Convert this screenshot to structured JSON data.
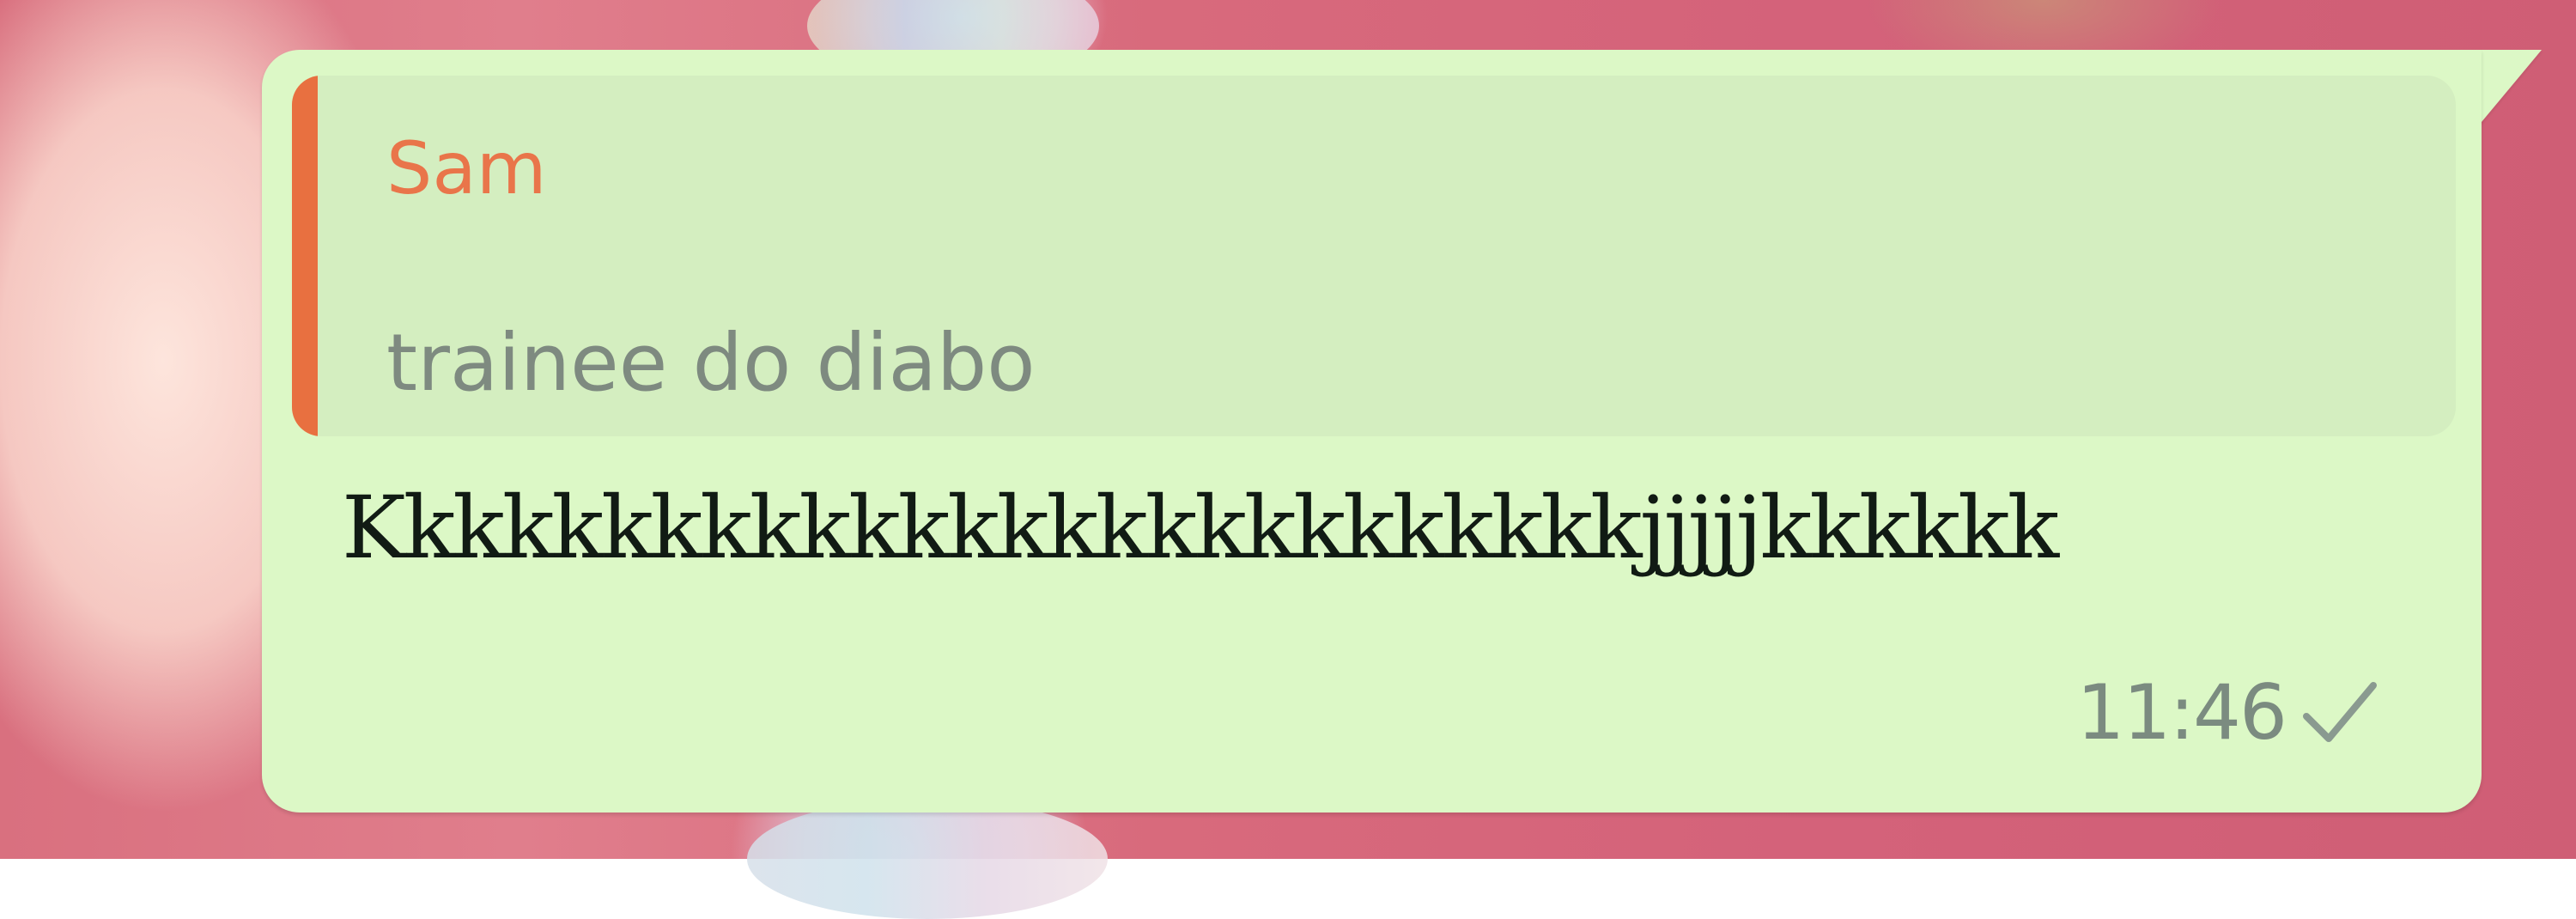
{
  "reply": {
    "sender": "Sam",
    "quoted_text": "trainee do diabo"
  },
  "message": {
    "text": "Kkkkkkkkkkkkkkkkkkkkkkkkkkjjjjjkkkkkk",
    "time": "11:46",
    "status_icon": "single-check-icon"
  },
  "colors": {
    "bubble": "#dcf8c6",
    "quote_bg": "#d4eec0",
    "quote_bar": "#e87040",
    "sender": "#e9754a"
  }
}
